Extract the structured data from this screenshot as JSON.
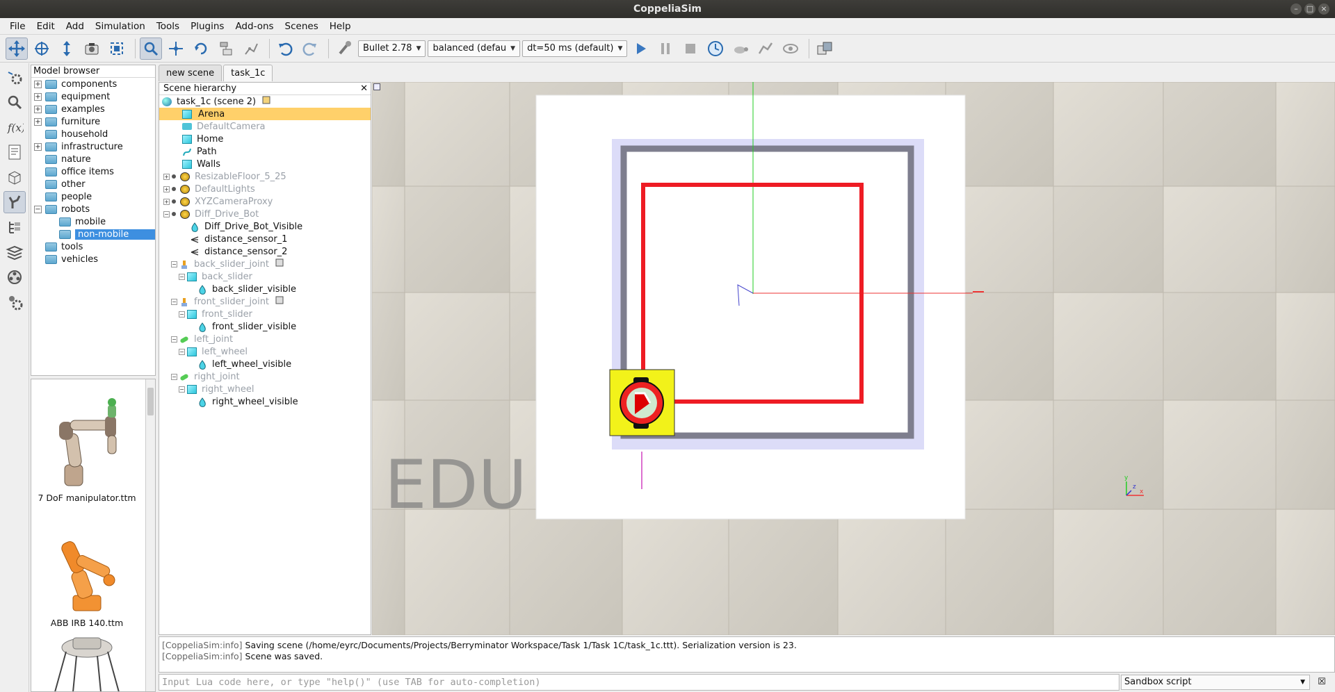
{
  "window": {
    "title": "CoppeliaSim"
  },
  "menu": [
    "File",
    "Edit",
    "Add",
    "Simulation",
    "Tools",
    "Plugins",
    "Add-ons",
    "Scenes",
    "Help"
  ],
  "toolbar": {
    "engine": "Bullet 2.78",
    "accuracy": "balanced (defau",
    "timestep": "dt=50 ms (default)"
  },
  "model_browser": {
    "title": "Model browser",
    "folders": [
      {
        "label": "components",
        "expander": "+"
      },
      {
        "label": "equipment",
        "expander": "+"
      },
      {
        "label": "examples",
        "expander": "+"
      },
      {
        "label": "furniture",
        "expander": "+"
      },
      {
        "label": "household",
        "expander": ""
      },
      {
        "label": "infrastructure",
        "expander": "+"
      },
      {
        "label": "nature",
        "expander": ""
      },
      {
        "label": "office items",
        "expander": ""
      },
      {
        "label": "other",
        "expander": ""
      },
      {
        "label": "people",
        "expander": ""
      },
      {
        "label": "robots",
        "expander": "−"
      },
      {
        "label": "mobile",
        "expander": ""
      },
      {
        "label": "non-mobile",
        "expander": ""
      },
      {
        "label": "tools",
        "expander": ""
      },
      {
        "label": "vehicles",
        "expander": ""
      }
    ],
    "thumbnails": [
      "7 DoF manipulator.ttm",
      "ABB IRB 140.ttm"
    ]
  },
  "scene_tabs": [
    "new scene",
    "task_1c"
  ],
  "hierarchy": {
    "title": "Scene hierarchy",
    "items": [
      {
        "label": "task_1c (scene 2)"
      },
      {
        "label": "Arena"
      },
      {
        "label": "DefaultCamera"
      },
      {
        "label": "Home"
      },
      {
        "label": "Path"
      },
      {
        "label": "Walls"
      },
      {
        "label": "ResizableFloor_5_25"
      },
      {
        "label": "DefaultLights"
      },
      {
        "label": "XYZCameraProxy"
      },
      {
        "label": "Diff_Drive_Bot"
      },
      {
        "label": "Diff_Drive_Bot_Visible"
      },
      {
        "label": "distance_sensor_1"
      },
      {
        "label": "distance_sensor_2"
      },
      {
        "label": "back_slider_joint"
      },
      {
        "label": "back_slider"
      },
      {
        "label": "back_slider_visible"
      },
      {
        "label": "front_slider_joint"
      },
      {
        "label": "front_slider"
      },
      {
        "label": "front_slider_visible"
      },
      {
        "label": "left_joint"
      },
      {
        "label": "left_wheel"
      },
      {
        "label": "left_wheel_visible"
      },
      {
        "label": "right_joint"
      },
      {
        "label": "right_wheel"
      },
      {
        "label": "right_wheel_visible"
      }
    ]
  },
  "viewport": {
    "watermark": "EDU",
    "axis_labels": [
      "y",
      "x",
      "z"
    ]
  },
  "console": {
    "lines": [
      {
        "tag": "[CoppeliaSim:info]",
        "text": " Saving scene (/home/eyrc/Documents/Projects/Berryminator Workspace/Task 1/Task 1C/task_1c.ttt). Serialization version is 23."
      },
      {
        "tag": "[CoppeliaSim:info]",
        "text": " Scene was saved."
      }
    ],
    "input_placeholder": "Input Lua code here, or type \"help()\" (use TAB for auto-completion)",
    "script_type": "Sandbox script"
  }
}
